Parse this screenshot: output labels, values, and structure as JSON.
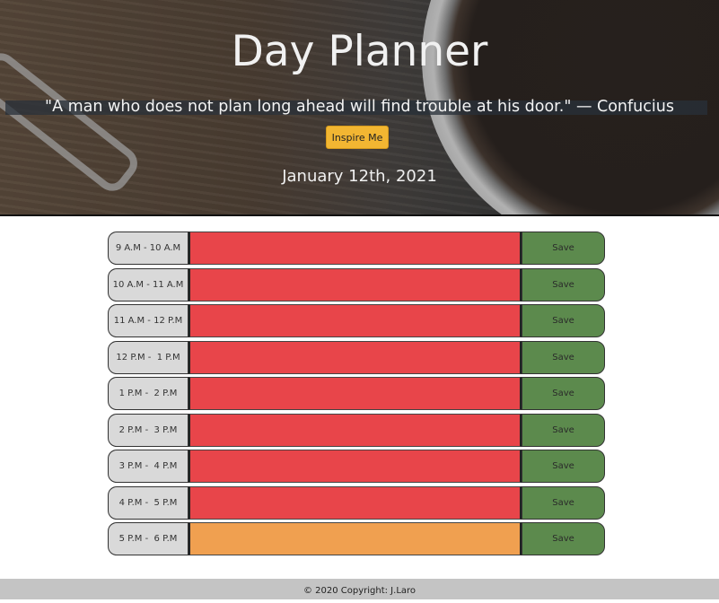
{
  "header": {
    "title": "Day Planner",
    "quote": "\"A man who does not plan long ahead will find trouble at his door.\" — Confucius",
    "inspire_label": "Inspire Me",
    "date": "January 12th, 2021"
  },
  "planner": {
    "rows": [
      {
        "hour": "9 A.M - 10 A.M",
        "save": "Save",
        "state": "past"
      },
      {
        "hour": "10 A.M - 11 A.M",
        "save": "Save",
        "state": "past"
      },
      {
        "hour": "11 A.M - 12 P.M",
        "save": "Save",
        "state": "past"
      },
      {
        "hour": "12 P.M -  1 P.M",
        "save": "Save",
        "state": "past"
      },
      {
        "hour": "1 P.M -  2 P.M",
        "save": "Save",
        "state": "past"
      },
      {
        "hour": "2 P.M -  3 P.M",
        "save": "Save",
        "state": "past"
      },
      {
        "hour": "3 P.M -  4 P.M",
        "save": "Save",
        "state": "past"
      },
      {
        "hour": "4 P.M -  5 P.M",
        "save": "Save",
        "state": "past"
      },
      {
        "hour": "5 P.M -  6 P.M",
        "save": "Save",
        "state": "present"
      }
    ]
  },
  "footer": {
    "text": "© 2020 Copyright: J.Laro"
  },
  "colors": {
    "past": "#e8454a",
    "present": "#f0a050",
    "save": "#5c8a4d",
    "inspire": "#f2b632"
  }
}
